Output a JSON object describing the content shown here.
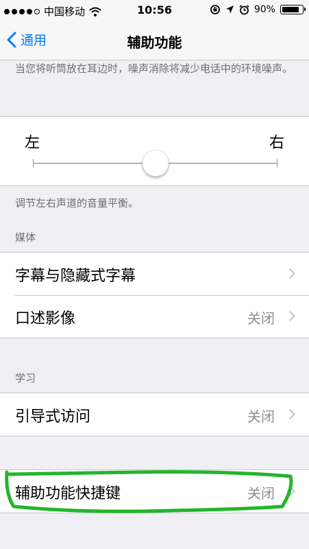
{
  "status_bar": {
    "carrier": "中国移动",
    "time": "10:56",
    "battery_text": "90%",
    "battery_level": 0.9,
    "signal_bars_filled": 4,
    "signal_bars_total": 5
  },
  "nav": {
    "back_label": "通用",
    "title": "辅助功能"
  },
  "noise_cancel_footer": "当您将听筒放在耳边时，噪声消除将减少电话中的环境噪声。",
  "balance": {
    "left_label": "左",
    "right_label": "右",
    "level": 0.5,
    "footer": "调节左右声道的音量平衡。"
  },
  "media": {
    "header": "媒体",
    "items": [
      {
        "label": "字幕与隐藏式字幕",
        "value": ""
      },
      {
        "label": "口述影像",
        "value": "关闭"
      }
    ]
  },
  "learning": {
    "header": "学习",
    "items": [
      {
        "label": "引导式访问",
        "value": "关闭"
      }
    ]
  },
  "shortcut": {
    "label": "辅助功能快捷键",
    "value": "关闭"
  },
  "colors": {
    "accent": "#007aff",
    "highlight_stroke": "#22b52a",
    "background": "#efeff4"
  },
  "icons": [
    "wifi-icon",
    "rotation-lock-icon",
    "location-arrow-icon",
    "alarm-icon",
    "battery-icon",
    "chevron-left-icon",
    "chevron-right-icon"
  ]
}
